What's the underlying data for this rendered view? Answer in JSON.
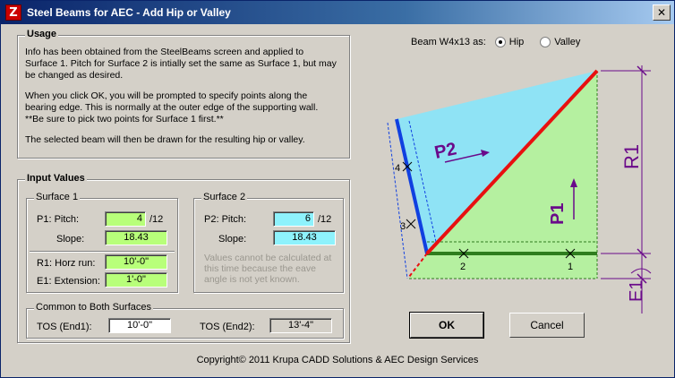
{
  "window": {
    "title": "Steel Beams for AEC - Add Hip or Valley",
    "app_icon_glyph": "Z",
    "close_glyph": "✕"
  },
  "usage": {
    "label": "Usage",
    "para1": "Info has been obtained from the SteelBeams screen and applied to Surface 1. Pitch for Surface 2 is intially set the same as Surface 1, but may be changed as desired.",
    "para2": "When you click OK, you will be prompted to specify points along the bearing edge. This is normally at the outer edge of the supporting wall.",
    "para3": "**Be sure to pick two points for Surface 1 first.**",
    "para4": "The selected beam will then be drawn for the resulting hip or valley."
  },
  "input_values": {
    "label": "Input Values",
    "surface1": {
      "label": "Surface 1",
      "pitch_label": "P1: Pitch:",
      "pitch_value": "4",
      "pitch_unit": "/12",
      "slope_label": "Slope:",
      "slope_value": "18.43",
      "horz_label": "R1: Horz run:",
      "horz_value": "10'-0\"",
      "ext_label": "E1: Extension:",
      "ext_value": "1'-0\""
    },
    "surface2": {
      "label": "Surface 2",
      "pitch_label": "P2: Pitch:",
      "pitch_value": "6",
      "pitch_unit": "/12",
      "slope_label": "Slope:",
      "slope_value": "18.43",
      "note": "Values cannot be calculated at this time because the eave angle is not yet known."
    },
    "common": {
      "label": "Common to Both Surfaces",
      "tos1_label": "TOS (End1):",
      "tos1_value": "10'-0\"",
      "tos2_label": "TOS (End2):",
      "tos2_value": "13'-4\""
    }
  },
  "beam_selection": {
    "label": "Beam W4x13 as:",
    "options": [
      "Hip",
      "Valley"
    ],
    "selected": "Hip"
  },
  "diagram": {
    "labels": {
      "p2": "P2",
      "p1": "P1",
      "r1": "R1",
      "e1": "E1",
      "m1": "1",
      "m2": "2",
      "m3": "3",
      "m4": "4"
    },
    "colors": {
      "surface2_fill": "#8fe3f5",
      "surface1_fill": "#b5f0a0",
      "hip_line": "#e81010",
      "left_beam": "#1040e0",
      "eave": "#2e7d1e",
      "dimension": "#6a0a8a"
    }
  },
  "buttons": {
    "ok": "OK",
    "cancel": "Cancel"
  },
  "footer": {
    "copyright": "Copyright© 2011  Krupa CADD Solutions & AEC Design Services"
  }
}
